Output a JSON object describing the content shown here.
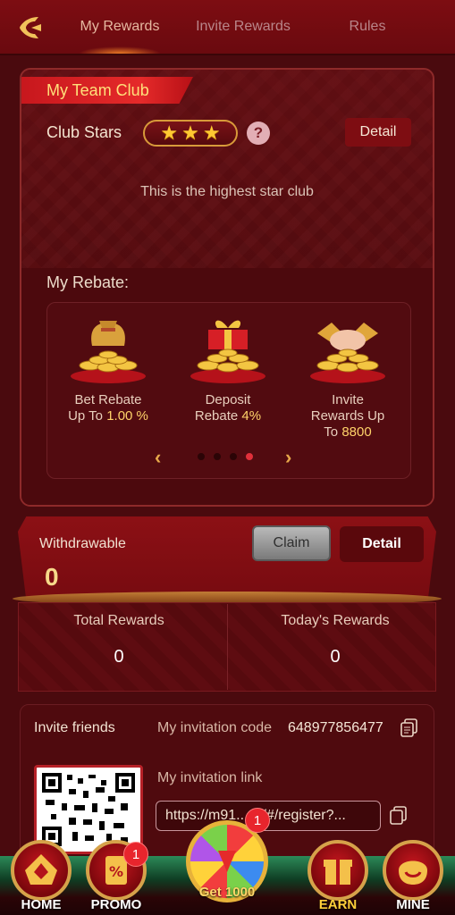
{
  "header": {
    "tabs": [
      {
        "label": "My Rewards"
      },
      {
        "label": "Invite Rewards"
      },
      {
        "label": "Rules"
      }
    ],
    "active_tab": "My Rewards"
  },
  "club": {
    "title": "My Team Club",
    "stars_label": "Club Stars",
    "stars": 3,
    "help_label": "?",
    "detail_label": "Detail",
    "status": "This is the highest star club"
  },
  "rebate": {
    "title": "My Rebate:",
    "items": [
      {
        "line1": "Bet Rebate",
        "line2_prefix": "Up To ",
        "line2_value": "1.00 %",
        "line3_prefix": "",
        "line3_value": ""
      },
      {
        "line1": "Deposit",
        "line2_prefix": "Rebate ",
        "line2_value": "4%",
        "line3_prefix": "",
        "line3_value": ""
      },
      {
        "line1": "Invite",
        "line2_prefix": "Rewards Up",
        "line2_value": "",
        "line3_prefix": "To ",
        "line3_value": "8800"
      }
    ],
    "page_count": 4,
    "active_page": 4,
    "prev_icon": "chevron-left-icon",
    "next_icon": "chevron-right-icon"
  },
  "withdraw": {
    "label": "Withdrawable",
    "amount": "0",
    "claim_label": "Claim",
    "detail_label": "Detail"
  },
  "rewards": {
    "total_label": "Total Rewards",
    "total_value": "0",
    "today_label": "Today's Rewards",
    "today_value": "0"
  },
  "invite": {
    "friends_label": "Invite friends",
    "code_label": "My invitation code",
    "code": "648977856477",
    "link_label": "My invitation link",
    "link": "https://m91...vs/#/register?..."
  },
  "bottom_nav": {
    "home": "HOME",
    "promo": "PROMO",
    "promo_badge": "1",
    "spin": "Get 1000",
    "spin_badge": "1",
    "earn": "EARN",
    "mine": "MINE"
  },
  "colors": {
    "background": "#4a0a0e",
    "accent_gold": "#ffd36a",
    "ribbon_red": "#e52a2a"
  }
}
